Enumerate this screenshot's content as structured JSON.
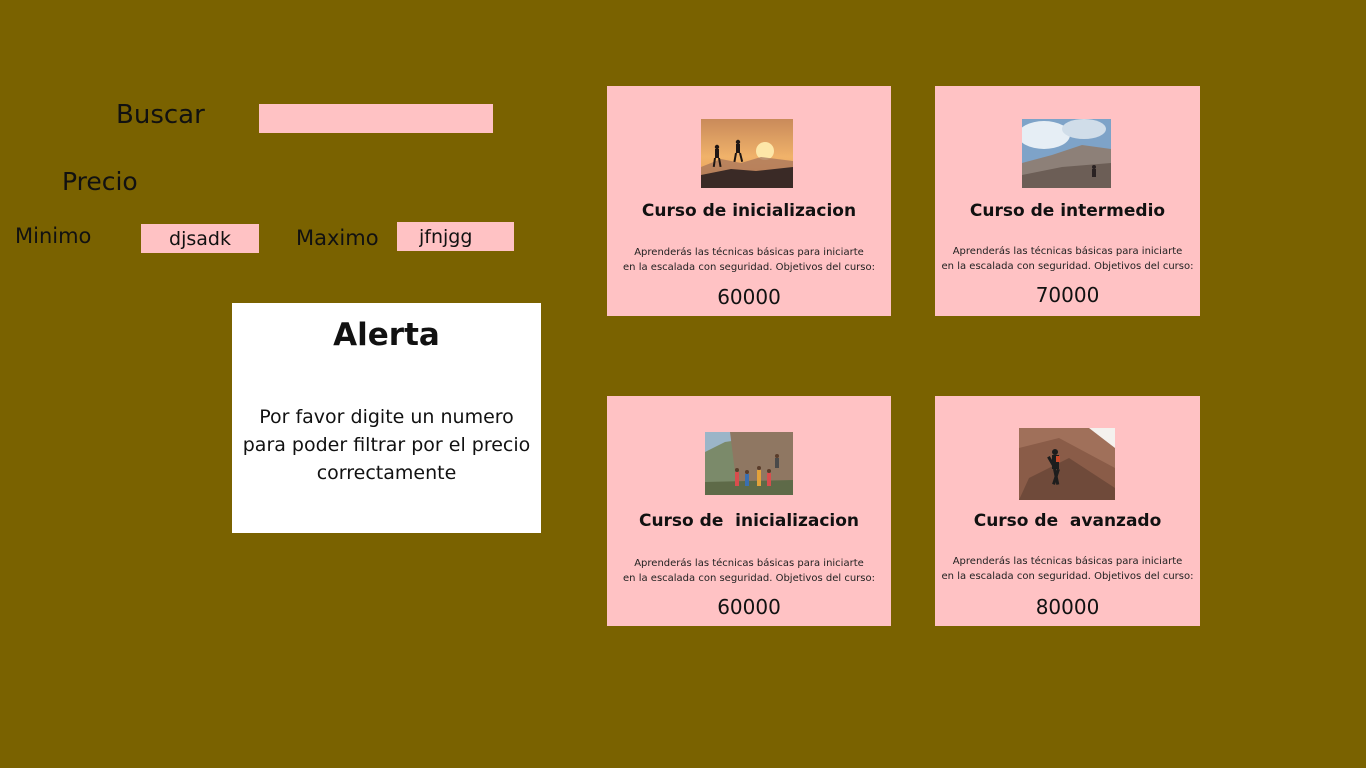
{
  "filters": {
    "search_label": "Buscar",
    "search_value": "",
    "price_label": "Precio",
    "min_label": "Minimo",
    "min_value": "djsadk",
    "max_label": "Maximo",
    "max_value": "jfnjgg"
  },
  "alert": {
    "title": "Alerta",
    "message": "Por favor digite un numero para poder filtrar por el precio correctamente"
  },
  "courses": [
    {
      "title": "Curso de inicializacion",
      "desc_line1": "Aprenderás las técnicas básicas para iniciarte",
      "desc_line2": "en la escalada con seguridad. Objetivos del curso:",
      "price": "60000",
      "image": "hikers-sunset-photo"
    },
    {
      "title": "Curso de intermedio",
      "desc_line1": "Aprenderás las técnicas básicas para iniciarte",
      "desc_line2": "en la escalada con seguridad. Objetivos del curso:",
      "price": "70000",
      "image": "rock-slab-climber-photo"
    },
    {
      "title": "Curso de  inicializacion",
      "desc_line1": "Aprenderás las técnicas básicas para iniciarte",
      "desc_line2": "en la escalada con seguridad. Objetivos del curso:",
      "price": "60000",
      "image": "group-climbing-wall-photo"
    },
    {
      "title": "Curso de  avanzado",
      "desc_line1": "Aprenderás las técnicas básicas para iniciarte",
      "desc_line2": "en la escalada con seguridad. Objetivos del curso:",
      "price": "80000",
      "image": "climber-on-rock-photo"
    }
  ],
  "colors": {
    "background": "#7a6200",
    "field_and_card": "#ffc2c4",
    "alert_background": "#ffffff"
  }
}
